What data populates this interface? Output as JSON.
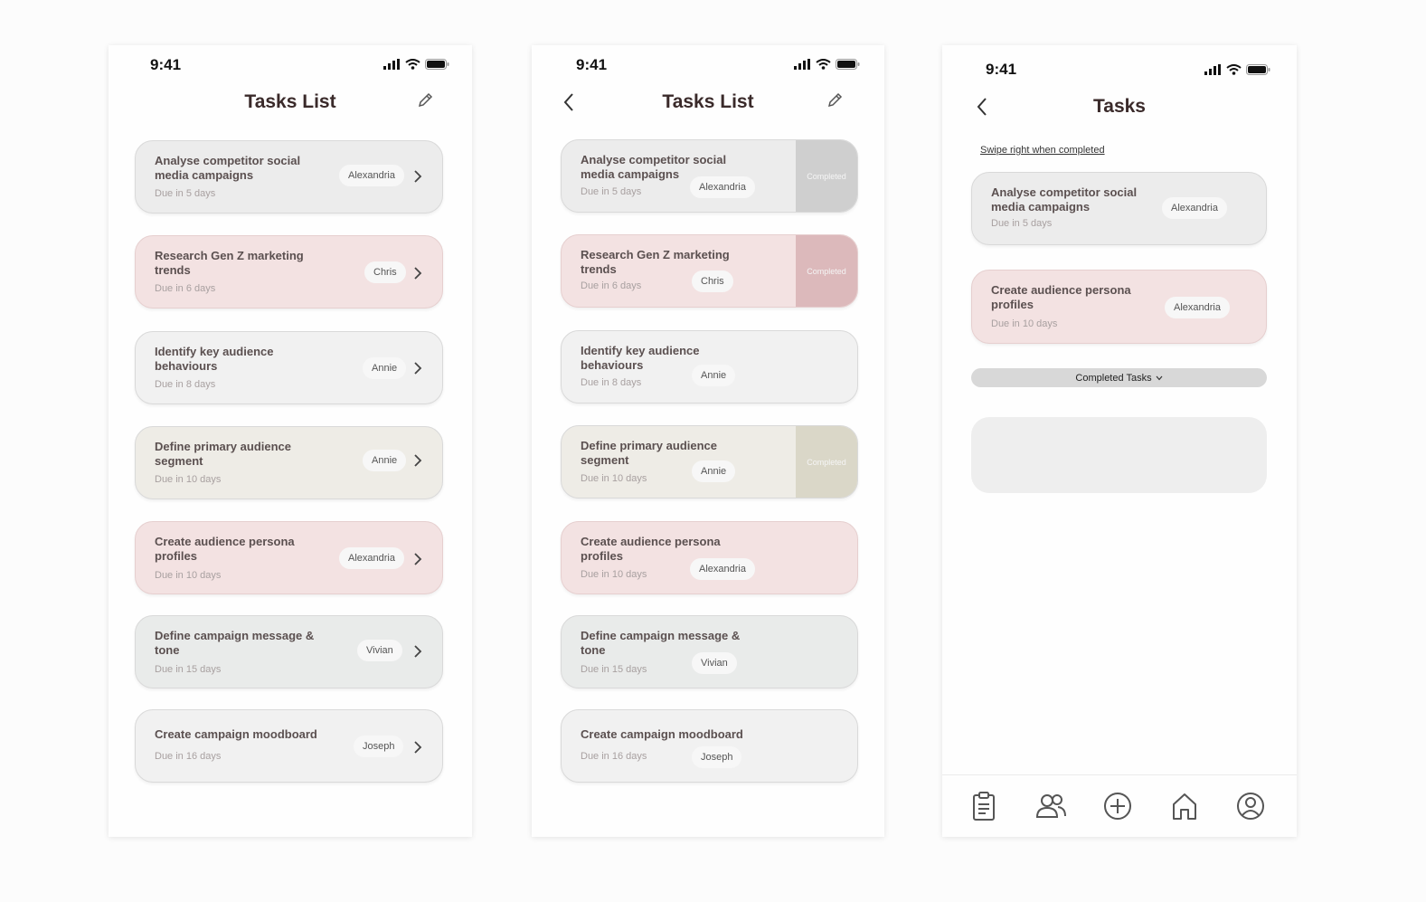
{
  "screens": [
    {
      "status_time": "9:41",
      "title": "Tasks List",
      "tasks": [
        {
          "name": "Analyse competitor social media campaigns",
          "assignee": "Alexandria",
          "due": "Due in 5 days"
        },
        {
          "name": "Research Gen Z marketing trends",
          "assignee": "Chris",
          "due": "Due in 6 days"
        },
        {
          "name": "Identify key audience behaviours",
          "assignee": "Annie",
          "due": "Due in 8 days"
        },
        {
          "name": "Define primary audience segment",
          "assignee": "Annie",
          "due": "Due in 10 days"
        },
        {
          "name": "Create audience persona profiles",
          "assignee": "Alexandria",
          "due": "Due in 10 days"
        },
        {
          "name": "Define campaign message & tone",
          "assignee": "Vivian",
          "due": "Due in 15 days"
        },
        {
          "name": "Create campaign moodboard",
          "assignee": "Joseph",
          "due": "Due in 16 days"
        }
      ]
    },
    {
      "status_time": "9:41",
      "title": "Tasks List",
      "completed_label": "Completed",
      "tasks": [
        {
          "name": "Analyse competitor social media campaigns",
          "assignee": "Alexandria",
          "due": "Due in 5 days"
        },
        {
          "name": "Research Gen Z marketing trends",
          "assignee": "Chris",
          "due": "Due in 6 days"
        },
        {
          "name": "Identify key audience behaviours",
          "assignee": "Annie",
          "due": "Due in 8 days"
        },
        {
          "name": "Define primary audience segment",
          "assignee": "Annie",
          "due": "Due in 10 days"
        },
        {
          "name": "Create audience persona profiles",
          "assignee": "Alexandria",
          "due": "Due in 10 days"
        },
        {
          "name": "Define campaign message & tone",
          "assignee": "Vivian",
          "due": "Due in 15 days"
        },
        {
          "name": "Create campaign moodboard",
          "assignee": "Joseph",
          "due": "Due in 16 days"
        }
      ]
    },
    {
      "status_time": "9:41",
      "title": "Tasks",
      "swipe_hint": "Swipe right when completed",
      "completed_tasks_label": "Completed Tasks",
      "tasks": [
        {
          "name": "Analyse competitor social media campaigns",
          "assignee": "Alexandria",
          "due": "Due in 5 days"
        },
        {
          "name": "Create audience persona profiles",
          "assignee": "Alexandria",
          "due": "Due in 10 days"
        }
      ],
      "tab_icons": [
        "clipboard-icon",
        "people-icon",
        "add-circle-icon",
        "home-icon",
        "profile-icon"
      ]
    }
  ],
  "colors": {
    "card_grey": "#ececec",
    "card_pink": "#f3e2e2",
    "card_beige": "#eeece6",
    "completed_grey": "#cfcfcf",
    "completed_pink": "#dcb9bb",
    "completed_beige": "#dad7c8"
  }
}
